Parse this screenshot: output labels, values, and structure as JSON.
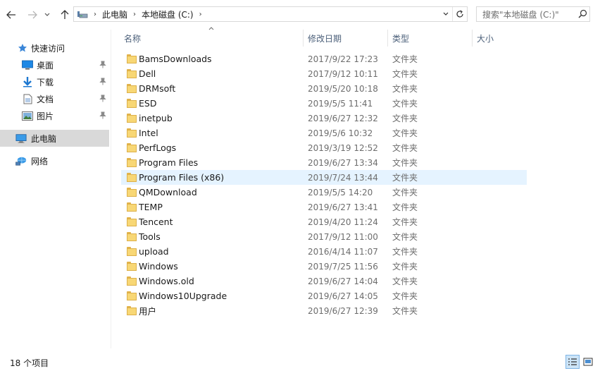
{
  "address": {
    "crumbs": [
      "此电脑",
      "本地磁盘 (C:)"
    ]
  },
  "search": {
    "placeholder": "搜索\"本地磁盘 (C:)\""
  },
  "sidebar": {
    "items": [
      {
        "label": "快速访问"
      },
      {
        "label": "桌面"
      },
      {
        "label": "下载"
      },
      {
        "label": "文档"
      },
      {
        "label": "图片"
      },
      {
        "label": "此电脑"
      },
      {
        "label": "网络"
      }
    ]
  },
  "columns": {
    "name": "名称",
    "date": "修改日期",
    "type": "类型",
    "size": "大小"
  },
  "files": [
    {
      "name": "BamsDownloads",
      "date": "2017/9/22 17:23",
      "type": "文件夹"
    },
    {
      "name": "Dell",
      "date": "2017/9/12 10:11",
      "type": "文件夹"
    },
    {
      "name": "DRMsoft",
      "date": "2019/5/20 10:18",
      "type": "文件夹"
    },
    {
      "name": "ESD",
      "date": "2019/5/5 11:41",
      "type": "文件夹"
    },
    {
      "name": "inetpub",
      "date": "2019/6/27 12:32",
      "type": "文件夹"
    },
    {
      "name": "Intel",
      "date": "2019/5/6 10:32",
      "type": "文件夹"
    },
    {
      "name": "PerfLogs",
      "date": "2019/3/19 12:52",
      "type": "文件夹"
    },
    {
      "name": "Program Files",
      "date": "2019/6/27 13:34",
      "type": "文件夹"
    },
    {
      "name": "Program Files (x86)",
      "date": "2019/7/24 13:44",
      "type": "文件夹"
    },
    {
      "name": "QMDownload",
      "date": "2019/5/5 14:20",
      "type": "文件夹"
    },
    {
      "name": "TEMP",
      "date": "2019/6/27 13:41",
      "type": "文件夹"
    },
    {
      "name": "Tencent",
      "date": "2019/4/20 11:24",
      "type": "文件夹"
    },
    {
      "name": "Tools",
      "date": "2017/9/12 11:00",
      "type": "文件夹"
    },
    {
      "name": "upload",
      "date": "2016/4/14 11:07",
      "type": "文件夹"
    },
    {
      "name": "Windows",
      "date": "2019/7/25 11:56",
      "type": "文件夹"
    },
    {
      "name": "Windows.old",
      "date": "2019/6/27 14:04",
      "type": "文件夹"
    },
    {
      "name": "Windows10Upgrade",
      "date": "2019/6/27 14:05",
      "type": "文件夹"
    },
    {
      "name": "用户",
      "date": "2019/6/27 12:39",
      "type": "文件夹"
    }
  ],
  "status": {
    "count": "18 个项目"
  },
  "icons": {
    "back": "back-arrow-icon",
    "forward": "forward-arrow-icon",
    "recent": "chevron-down-icon",
    "up": "up-arrow-icon",
    "drive": "drive-icon",
    "refresh": "refresh-icon",
    "search": "search-icon",
    "star": "star-icon",
    "desktop": "desktop-icon",
    "download": "download-icon",
    "document": "document-icon",
    "picture": "picture-icon",
    "computer": "computer-icon",
    "network": "network-icon",
    "folder": "folder-icon",
    "pin": "pin-icon",
    "details_view": "details-view-icon",
    "large_icons_view": "large-icons-view-icon"
  },
  "colors": {
    "accent": "#0078d7",
    "selected_bg": "#d9d9d9",
    "hover_bg": "#e5f3ff",
    "header_text": "#4c607a",
    "folder": "#f8d775"
  }
}
